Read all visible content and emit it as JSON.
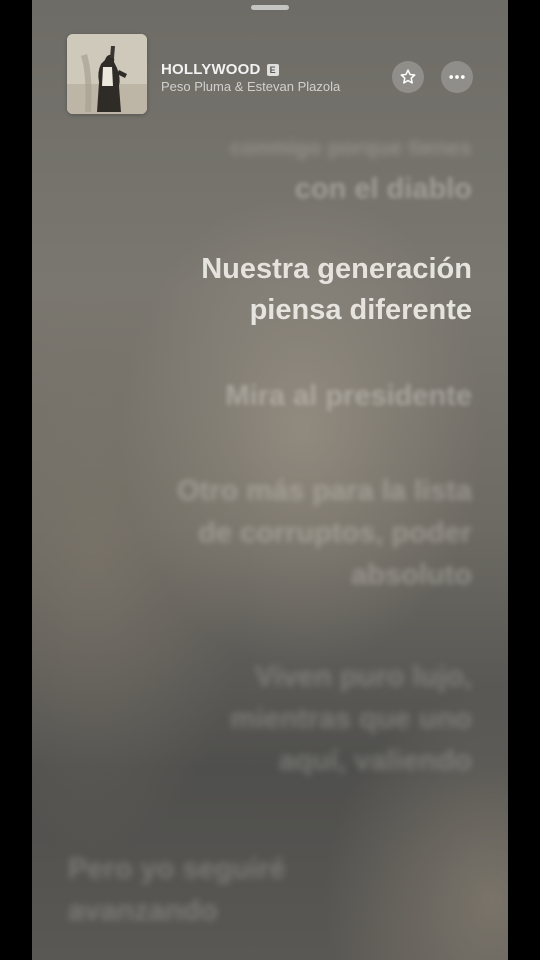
{
  "now_playing": {
    "title": "HOLLYWOOD",
    "explicit_badge": "E",
    "artist": "Peso Pluma & Estevan Plazola"
  },
  "actions": {
    "favorite_icon": "star-icon",
    "more_icon": "ellipsis-icon"
  },
  "lyrics": {
    "prev_partial": "conmigo porque tienes",
    "prev": "con el diablo",
    "current_line1": "Nuestra generación",
    "current_line2": "piensa diferente",
    "next1": "Mira al presidente",
    "next2_line1": "Otro más para la lista",
    "next2_line2": "de corruptos, poder",
    "next2_line3": "absoluto",
    "next3_line1": "Viven puro lujo,",
    "next3_line2": "mientras que uno",
    "next3_line3": "aquí, valiendo",
    "next4_line1": "Pero yo seguiré",
    "next4_line2": "avanzando"
  }
}
